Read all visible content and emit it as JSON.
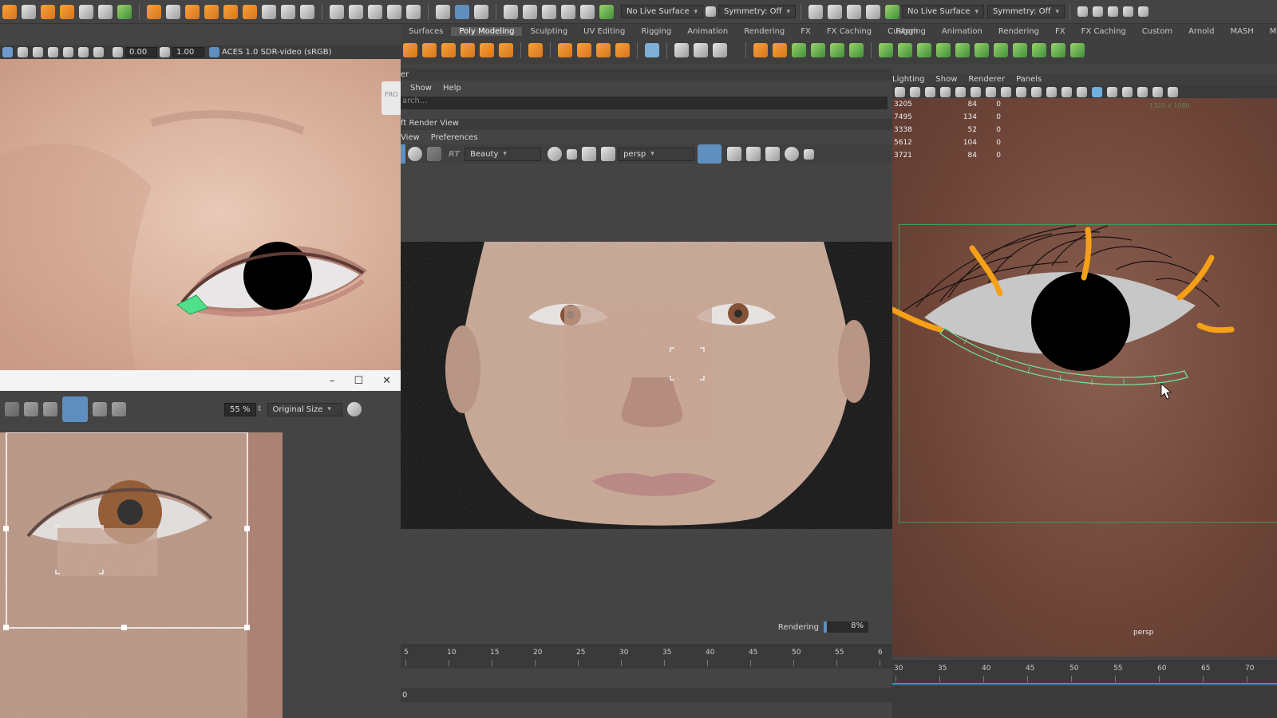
{
  "topbar": {
    "live_surface_1": "No Live Surface",
    "symmetry_1": "Symmetry: Off",
    "live_surface_2": "No Live Surface",
    "symmetry_2": "Symmetry: Off"
  },
  "uv_toolbar": {
    "value_a": "0.00",
    "value_b": "1.00",
    "colorspace": "ACES 1.0 SDR-video (sRGB)"
  },
  "shelf_tabs_center": [
    "Surfaces",
    "Poly Modeling",
    "Sculpting",
    "UV Editing",
    "Rigging",
    "Animation",
    "Rendering",
    "FX",
    "FX Caching",
    "Custom"
  ],
  "shelf_tabs_right": [
    "Rigging",
    "Animation",
    "Rendering",
    "FX",
    "FX Caching",
    "Custom",
    "Arnold",
    "MASH",
    "Motion Grap"
  ],
  "outliner": {
    "title_fragment": "er",
    "menu": [
      "Show",
      "Help"
    ],
    "search_placeholder": "arch..."
  },
  "render_view": {
    "title": "ft Render View",
    "menu": [
      "View",
      "Preferences"
    ],
    "aov": "Beauty",
    "camera": "persp",
    "status_label": "Rendering",
    "progress_text": "8%",
    "progress": 0.08,
    "frame_field": "0"
  },
  "right_panel": {
    "menu": [
      "Lighting",
      "Show",
      "Renderer",
      "Panels"
    ],
    "stats": [
      {
        "a": "3205",
        "b": "84",
        "c": "0"
      },
      {
        "a": "7495",
        "b": "134",
        "c": "0"
      },
      {
        "a": "3338",
        "b": "52",
        "c": "0"
      },
      {
        "a": "5612",
        "b": "104",
        "c": "0"
      },
      {
        "a": "3721",
        "b": "84",
        "c": "0"
      }
    ],
    "resolution": "1320 x 1080",
    "camera_label": "persp"
  },
  "float_window": {
    "zoom": "55 %",
    "size_option": "Original Size"
  },
  "timeline_center": [
    "5",
    "10",
    "15",
    "20",
    "25",
    "30",
    "35",
    "40",
    "45",
    "50",
    "55",
    "6"
  ],
  "timeline_right": [
    "30",
    "35",
    "40",
    "45",
    "50",
    "55",
    "60",
    "65",
    "70"
  ],
  "left_side_tab": "FRO"
}
